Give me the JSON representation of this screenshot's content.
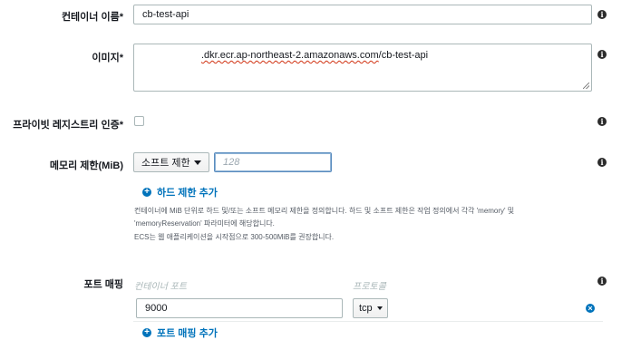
{
  "container_name": {
    "label": "컨테이너 이름*",
    "value": "cb-test-api"
  },
  "image": {
    "label": "이미지*",
    "value_underlined": ".dkr.ecr.ap-northeast-2.amazonaws.com",
    "value_suffix": "/cb-test-api"
  },
  "private_registry": {
    "label": "프라이빗 레지스트리 인증*",
    "checked": false
  },
  "memory_limit": {
    "label": "메모리 제한(MiB)",
    "limit_type": "소프트 제한",
    "value_placeholder": "128",
    "add_hard_limit": "하드 제한 추가",
    "help_line1": "컨테이너에 MiB 단위로 하드 및/또는 소프트 메모리 제한을 정의합니다. 하드 및 소프트 제한은 작업 정의에서 각각 'memory' 및",
    "help_line2": "'memoryReservation' 파라미터에 해당합니다.",
    "help_line3": "ECS는 웹 애플리케이션을 시작점으로 300-500MiB를 권장합니다."
  },
  "port_mappings": {
    "label": "포트 매핑",
    "col_container_port": "컨테이너 포트",
    "col_protocol": "프로토콜",
    "rows": [
      {
        "container_port": "9000",
        "protocol": "tcp"
      }
    ],
    "add_mapping": "포트 매핑 추가"
  },
  "icons": {
    "info": "i",
    "plus": "+",
    "remove": "×"
  },
  "colors": {
    "link": "#0073bb",
    "focus_border": "#5a8dbf",
    "spellcheck": "#d13212"
  }
}
